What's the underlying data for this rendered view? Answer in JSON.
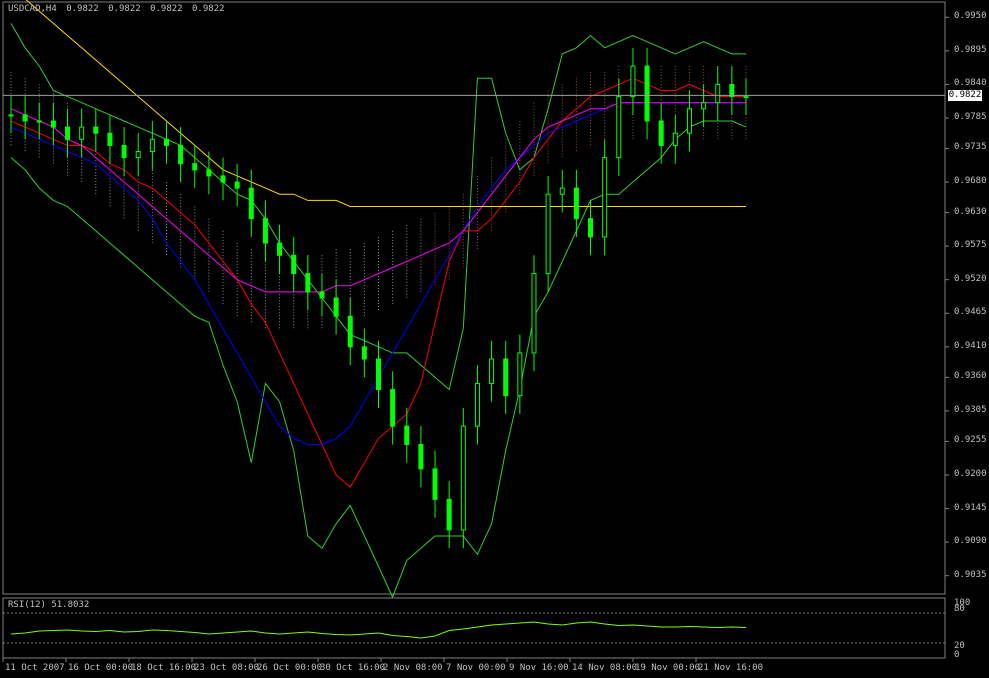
{
  "header": {
    "symbol": "USDCAD,H4",
    "ohlc": [
      "0.9822",
      "0.9822",
      "0.9822",
      "0.9822"
    ]
  },
  "current_price_label": "0.9822",
  "rsi_panel": {
    "title": "RSI(12) 51.8032",
    "scale_labels": [
      "100",
      "80",
      "20",
      "0"
    ]
  },
  "colors": {
    "background": "#000000",
    "candles": "#00ff00",
    "bollinger": "#32cd32",
    "ichimoku_cloud_down": "#ffffff",
    "ichimoku_cloud_up": "#ff9966",
    "ma_fast": "#ff0000",
    "ma_mid": "#0000ff",
    "ma_slow": "#ff00ff",
    "ma_long": "#ffd700",
    "rsi_line": "#7fff00"
  },
  "chart_data": {
    "type": "line",
    "title": "USDCAD,H4",
    "ylim": [
      0.9005,
      0.9975
    ],
    "y_ticks": [
      "0.9950",
      "0.9895",
      "0.9840",
      "0.9785",
      "0.9735",
      "0.9680",
      "0.9630",
      "0.9575",
      "0.9520",
      "0.9465",
      "0.9410",
      "0.9360",
      "0.9305",
      "0.9255",
      "0.9200",
      "0.9145",
      "0.9090",
      "0.9035"
    ],
    "x_tick_labels": [
      "11 Oct 2007",
      "16 Oct 00:00",
      "18 Oct 16:00",
      "23 Oct 08:00",
      "26 Oct 00:00",
      "30 Oct 16:00",
      "2 Nov 08:00",
      "7 Nov 00:00",
      "9 Nov 16:00",
      "14 Nov 08:00",
      "19 Nov 00:00",
      "21 Nov 16:00"
    ],
    "grid": false,
    "price_close": [
      0.979,
      0.978,
      0.978,
      0.977,
      0.975,
      0.977,
      0.976,
      0.974,
      0.972,
      0.973,
      0.975,
      0.974,
      0.971,
      0.97,
      0.969,
      0.968,
      0.967,
      0.962,
      0.958,
      0.956,
      0.953,
      0.95,
      0.949,
      0.946,
      0.941,
      0.939,
      0.934,
      0.928,
      0.925,
      0.921,
      0.916,
      0.911,
      0.928,
      0.935,
      0.939,
      0.933,
      0.94,
      0.953,
      0.966,
      0.967,
      0.962,
      0.959,
      0.972,
      0.982,
      0.987,
      0.978,
      0.974,
      0.976,
      0.98,
      0.981,
      0.984,
      0.982,
      0.982
    ],
    "series": [
      {
        "name": "Bollinger Upper",
        "values": [
          0.994,
          0.99,
          0.987,
          0.983,
          0.982,
          0.981,
          0.98,
          0.979,
          0.978,
          0.977,
          0.976,
          0.975,
          0.974,
          0.972,
          0.97,
          0.968,
          0.966,
          0.965,
          0.962,
          0.958,
          0.955,
          0.952,
          0.949,
          0.946,
          0.943,
          0.942,
          0.941,
          0.94,
          0.94,
          0.938,
          0.936,
          0.934,
          0.944,
          0.985,
          0.985,
          0.976,
          0.97,
          0.972,
          0.98,
          0.989,
          0.99,
          0.992,
          0.99,
          0.991,
          0.992,
          0.991,
          0.99,
          0.989,
          0.99,
          0.991,
          0.99,
          0.989,
          0.989
        ]
      },
      {
        "name": "Bollinger Lower",
        "values": [
          0.972,
          0.97,
          0.967,
          0.965,
          0.964,
          0.962,
          0.96,
          0.958,
          0.956,
          0.954,
          0.952,
          0.95,
          0.948,
          0.946,
          0.945,
          0.938,
          0.932,
          0.922,
          0.935,
          0.932,
          0.924,
          0.91,
          0.908,
          0.912,
          0.915,
          0.91,
          0.905,
          0.9,
          0.906,
          0.908,
          0.91,
          0.91,
          0.91,
          0.907,
          0.912,
          0.924,
          0.934,
          0.946,
          0.95,
          0.955,
          0.96,
          0.965,
          0.966,
          0.966,
          0.968,
          0.97,
          0.972,
          0.975,
          0.977,
          0.978,
          0.978,
          0.978,
          0.977
        ]
      },
      {
        "name": "MA Fast",
        "values": [
          0.978,
          0.977,
          0.976,
          0.975,
          0.974,
          0.974,
          0.973,
          0.971,
          0.97,
          0.968,
          0.967,
          0.965,
          0.963,
          0.961,
          0.958,
          0.955,
          0.952,
          0.948,
          0.945,
          0.94,
          0.935,
          0.93,
          0.925,
          0.92,
          0.918,
          0.922,
          0.926,
          0.928,
          0.93,
          0.935,
          0.945,
          0.955,
          0.96,
          0.96,
          0.962,
          0.965,
          0.968,
          0.972,
          0.975,
          0.978,
          0.98,
          0.982,
          0.983,
          0.984,
          0.985,
          0.984,
          0.983,
          0.983,
          0.984,
          0.983,
          0.982,
          0.982,
          0.982
        ]
      },
      {
        "name": "MA Mid",
        "values": [
          0.977,
          0.976,
          0.975,
          0.974,
          0.973,
          0.972,
          0.971,
          0.969,
          0.967,
          0.965,
          0.962,
          0.958,
          0.955,
          0.952,
          0.948,
          0.944,
          0.94,
          0.936,
          0.932,
          0.928,
          0.926,
          0.925,
          0.925,
          0.926,
          0.928,
          0.932,
          0.936,
          0.94,
          0.944,
          0.948,
          0.952,
          0.956,
          0.96,
          0.964,
          0.967,
          0.97,
          0.972,
          0.974,
          0.976,
          0.977,
          0.978,
          0.979,
          0.98,
          0.981,
          0.981,
          0.981,
          0.981,
          0.981,
          0.981,
          0.981,
          0.981,
          0.981,
          0.981
        ]
      },
      {
        "name": "MA Slow",
        "values": [
          0.98,
          0.979,
          0.978,
          0.977,
          0.975,
          0.974,
          0.972,
          0.97,
          0.968,
          0.966,
          0.964,
          0.962,
          0.96,
          0.958,
          0.956,
          0.954,
          0.952,
          0.951,
          0.95,
          0.95,
          0.95,
          0.95,
          0.95,
          0.951,
          0.951,
          0.952,
          0.953,
          0.954,
          0.955,
          0.956,
          0.957,
          0.958,
          0.96,
          0.963,
          0.966,
          0.969,
          0.972,
          0.975,
          0.977,
          0.978,
          0.979,
          0.98,
          0.98,
          0.981,
          0.981,
          0.981,
          0.981,
          0.981,
          0.981,
          0.981,
          0.981,
          0.981,
          0.981
        ]
      },
      {
        "name": "MA Long",
        "values": [
          0.999,
          0.998,
          0.996,
          0.994,
          0.992,
          0.99,
          0.988,
          0.986,
          0.984,
          0.982,
          0.98,
          0.978,
          0.976,
          0.974,
          0.972,
          0.97,
          0.969,
          0.968,
          0.967,
          0.966,
          0.966,
          0.965,
          0.965,
          0.965,
          0.964,
          0.964,
          0.964,
          0.964,
          0.964,
          0.964,
          0.964,
          0.964,
          0.964,
          0.964,
          0.964,
          0.964,
          0.964,
          0.964,
          0.964,
          0.964,
          0.964,
          0.964,
          0.964,
          0.964,
          0.964,
          0.964,
          0.964,
          0.964,
          0.964,
          0.964,
          0.964,
          0.964,
          0.964
        ]
      },
      {
        "name": "RSI(12)",
        "values": [
          38,
          40,
          44,
          45,
          46,
          44,
          43,
          45,
          42,
          43,
          46,
          45,
          43,
          41,
          38,
          40,
          42,
          44,
          40,
          38,
          40,
          42,
          39,
          37,
          36,
          38,
          40,
          35,
          33,
          30,
          34,
          45,
          48,
          52,
          56,
          58,
          60,
          62,
          58,
          56,
          60,
          62,
          58,
          55,
          56,
          54,
          52,
          52,
          53,
          52,
          51,
          52,
          51
        ]
      }
    ]
  }
}
